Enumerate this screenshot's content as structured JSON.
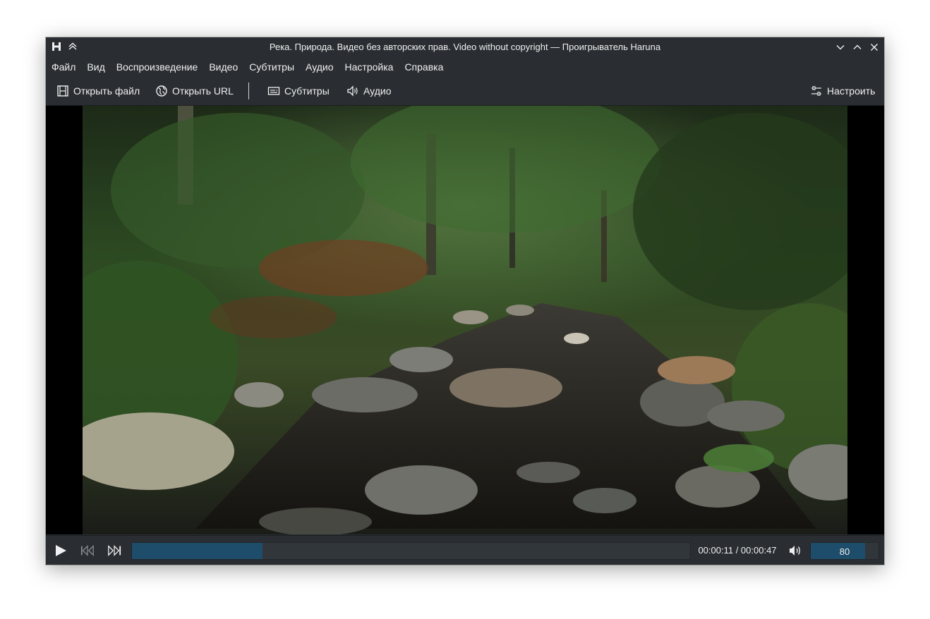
{
  "window": {
    "title": "Река. Природа. Видео без авторских прав. Video without copyright — Проигрыватель Haruna"
  },
  "menubar": {
    "items": [
      "Файл",
      "Вид",
      "Воспроизведение",
      "Видео",
      "Субтитры",
      "Аудио",
      "Настройка",
      "Справка"
    ]
  },
  "toolbar": {
    "open_file": "Открыть файл",
    "open_url": "Открыть URL",
    "subtitles": "Субтитры",
    "audio": "Аудио",
    "configure": "Настроить"
  },
  "playback": {
    "time": "00:00:11 / 00:00:47",
    "progress_fraction": 0.234,
    "volume": "80",
    "volume_fraction": 0.8
  },
  "colors": {
    "window_bg": "#2a2e32",
    "text": "#eff0f1",
    "accent_fill": "#1e4d6b",
    "slider_track": "#31363b"
  },
  "icons": {
    "app": "haruna-logo-icon",
    "keep_above": "keep-above-icon",
    "minimize": "chevron-down-icon",
    "maximize": "chevron-up-icon",
    "close": "close-icon",
    "open_file": "film-icon",
    "open_url": "globe-icon",
    "subtitles": "subtitles-icon",
    "audio": "speaker-icon",
    "configure": "sliders-icon",
    "play": "play-icon",
    "previous": "skip-back-icon",
    "next": "skip-forward-icon",
    "mute": "volume-icon"
  }
}
